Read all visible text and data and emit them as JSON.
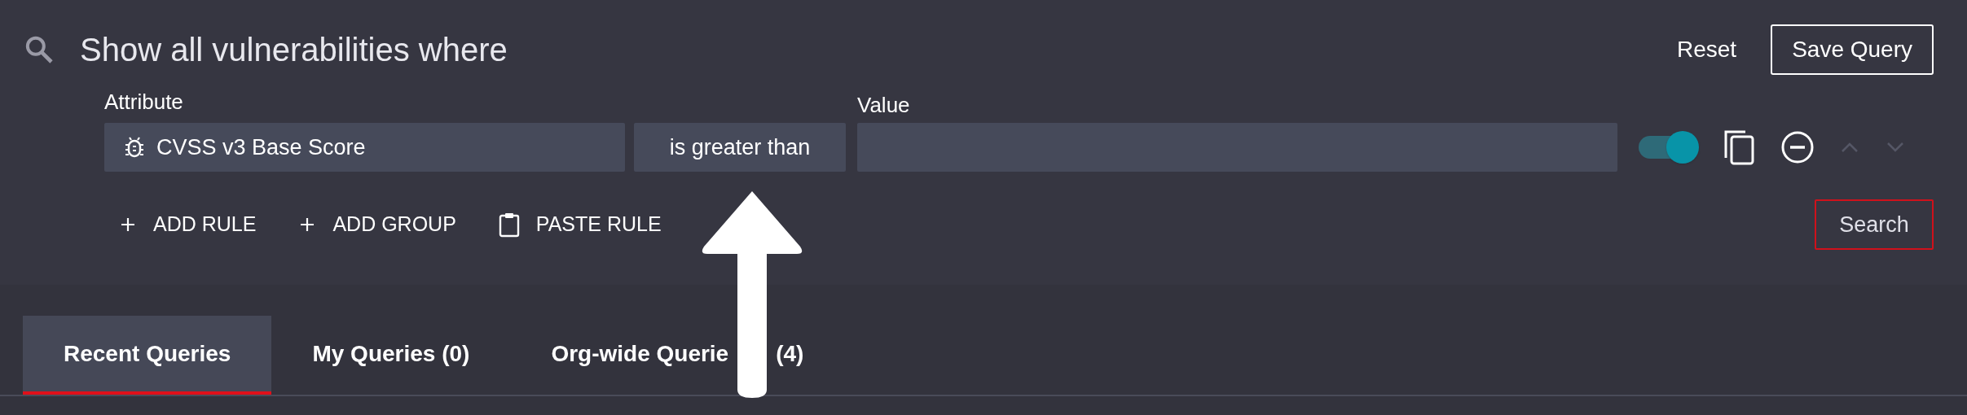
{
  "header": {
    "title": "Show all vulnerabilities where",
    "reset": "Reset",
    "save": "Save Query"
  },
  "rule": {
    "attribute_label": "Attribute",
    "attribute": "CVSS v3 Base Score",
    "operator": "is greater than",
    "value_label": "Value",
    "enabled": true
  },
  "actions": [
    {
      "kind": "plus",
      "label": "ADD RULE"
    },
    {
      "kind": "plus",
      "label": "ADD GROUP"
    },
    {
      "kind": "clipboard",
      "label": "PASTE RULE"
    }
  ],
  "search_button": "Search",
  "tabs": [
    {
      "label": "Recent Queries",
      "selected": true
    },
    {
      "label": "My Queries (0)",
      "selected": false
    },
    {
      "label": "Org-wide Querie",
      "count": "(4)",
      "selected": false
    }
  ]
}
